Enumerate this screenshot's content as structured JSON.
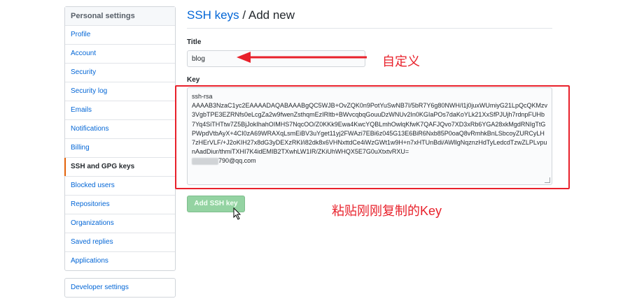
{
  "sidebar": {
    "header": "Personal settings",
    "items": [
      {
        "label": "Profile"
      },
      {
        "label": "Account"
      },
      {
        "label": "Security"
      },
      {
        "label": "Security log"
      },
      {
        "label": "Emails"
      },
      {
        "label": "Notifications"
      },
      {
        "label": "Billing"
      },
      {
        "label": "SSH and GPG keys",
        "selected": true
      },
      {
        "label": "Blocked users"
      },
      {
        "label": "Repositories"
      },
      {
        "label": "Organizations"
      },
      {
        "label": "Saved replies"
      },
      {
        "label": "Applications"
      }
    ],
    "developer_settings": "Developer settings"
  },
  "main": {
    "breadcrumb": "SSH keys",
    "separator": " / ",
    "title": "Add new",
    "title_label": "Title",
    "title_value": "blog",
    "key_label": "Key",
    "key_value": "ssh-rsa\nAAAAB3NzaC1yc2EAAAADAQABAAABgQC5WJB+OvZQK0n9PotYuSwNB7I/5bR7Y6g80NWH/l1j0juxWUmiyG21LpQcQKMzv3VgbTPE3EZRNfs0eLcgZa2w9fwenZsthqmEzIRltb+BWvcqbqGouuDzWNUv2In0KGIaPOs7daKoYLk21XxSfPJUjh7rdnpFUHb7Yq4SiTHTtw7Z5BjJokIhahOIMHS7NqcOO/Z0KKk9Ewa4KwcYQBLmhOwlqKfwK7QAFJQvo7XD3xRb6YGA28xkMgdRNIgTtGPWpdVtbAyX+4CI0zA69WRAXqLsmEiBV3uYget11yj2FWAzi7EBi6z045G13E6BiR6Nxb85P0oaQ8vRmhkBnLSbcoyZURCyLH7zHErVLF/+J2oKIH27x8dG3yDEXzRKl/i82dk8x6VHNxttdCe4iWzGWt1w9H+n7xHTUnBdi/AWllgNqznzHdTyLedcdTzwZLPLvpunAadDiur/thmiTXHI7K4idEMIB2TXwhLW1IR/ZKiUhWHQX5E7G0uXtxtvRXU=",
    "key_email": "790@qq.com",
    "add_button": "Add SSH key"
  },
  "annotations": {
    "title_note": "自定义",
    "key_note": "粘贴刚刚复制的Key",
    "color": "#e8212b"
  }
}
